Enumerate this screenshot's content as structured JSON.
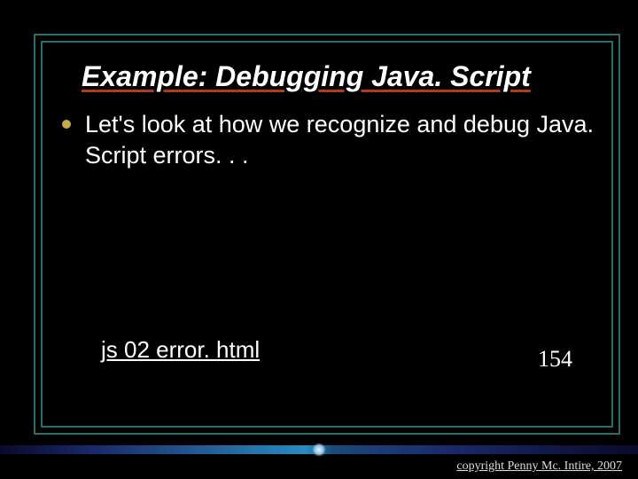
{
  "title": "Example: Debugging Java. Script",
  "bullets": [
    {
      "text": "Let's look at how we recognize and debug Java. Script errors. . ."
    }
  ],
  "link": "js 02 error. html",
  "pageNumber": "154",
  "copyright": "copyright Penny Mc. Intire, 2007"
}
